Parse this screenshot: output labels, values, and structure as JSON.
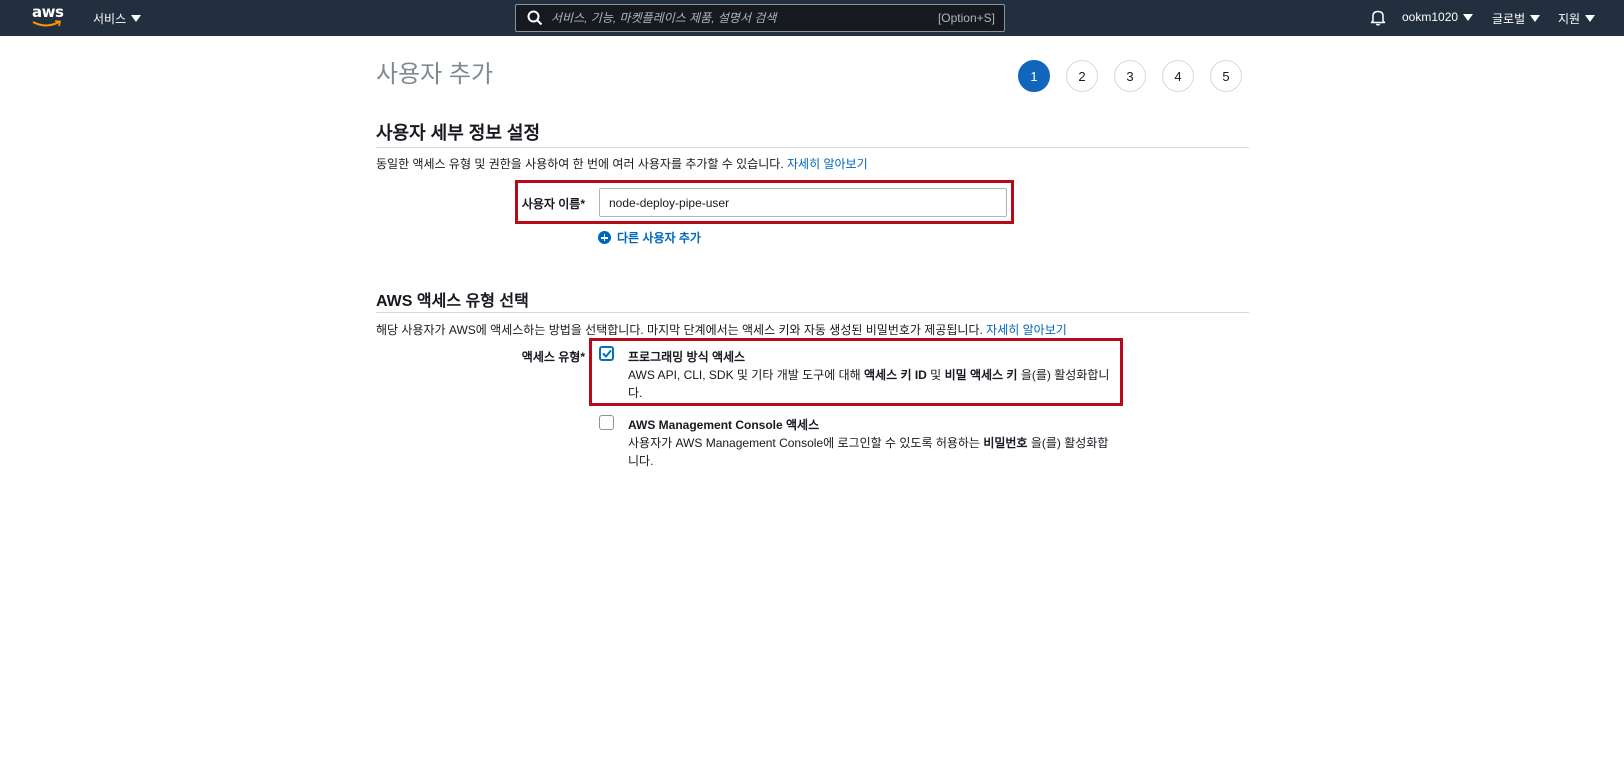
{
  "nav": {
    "logo_text": "aws",
    "services_label": "서비스",
    "search_placeholder": "서비스, 기능, 마켓플레이스 제품, 설명서 검색",
    "search_shortcut": "[Option+S]",
    "account_label": "ookm1020",
    "region_label": "글로벌",
    "support_label": "지원"
  },
  "page": {
    "title": "사용자 추가"
  },
  "steps": [
    "1",
    "2",
    "3",
    "4",
    "5"
  ],
  "active_step": "1",
  "user_details": {
    "section_title": "사용자 세부 정보 설정",
    "description": "동일한 액세스 유형 및 권한을 사용하여 한 번에 여러 사용자를 추가할 수 있습니다.",
    "learn_more": "자세히 알아보기",
    "username_label": "사용자 이름*",
    "username_value": "node-deploy-pipe-user",
    "add_user_label": "다른 사용자 추가"
  },
  "access_type": {
    "section_title": "AWS 액세스 유형 선택",
    "description": "해당 사용자가 AWS에 액세스하는 방법을 선택합니다. 마지막 단계에서는 액세스 키와 자동 생성된 비밀번호가 제공됩니다.",
    "learn_more": "자세히 알아보기",
    "label": "액세스 유형*",
    "options": [
      {
        "title": "프로그래밍 방식 액세스",
        "checked": true,
        "desc_part1": "AWS API, CLI, SDK 및 기타 개발 도구에 대해 ",
        "desc_bold1": "액세스 키 ID",
        "desc_part2": " 및 ",
        "desc_bold2": "비밀 액세스 키",
        "desc_part3": " 을(를) 활성화합니다."
      },
      {
        "title": "AWS Management Console 액세스",
        "checked": false,
        "desc_part1": "사용자가 AWS Management Console에 로그인할 수 있도록 허용하는 ",
        "desc_bold1": "비밀번호",
        "desc_part2": " 을(를) 활성화합니다."
      }
    ]
  },
  "colors": {
    "nav_bg": "#232f3e",
    "accent": "#0066bb",
    "active_step": "#1166bb",
    "highlight_border": "#b7091a"
  }
}
